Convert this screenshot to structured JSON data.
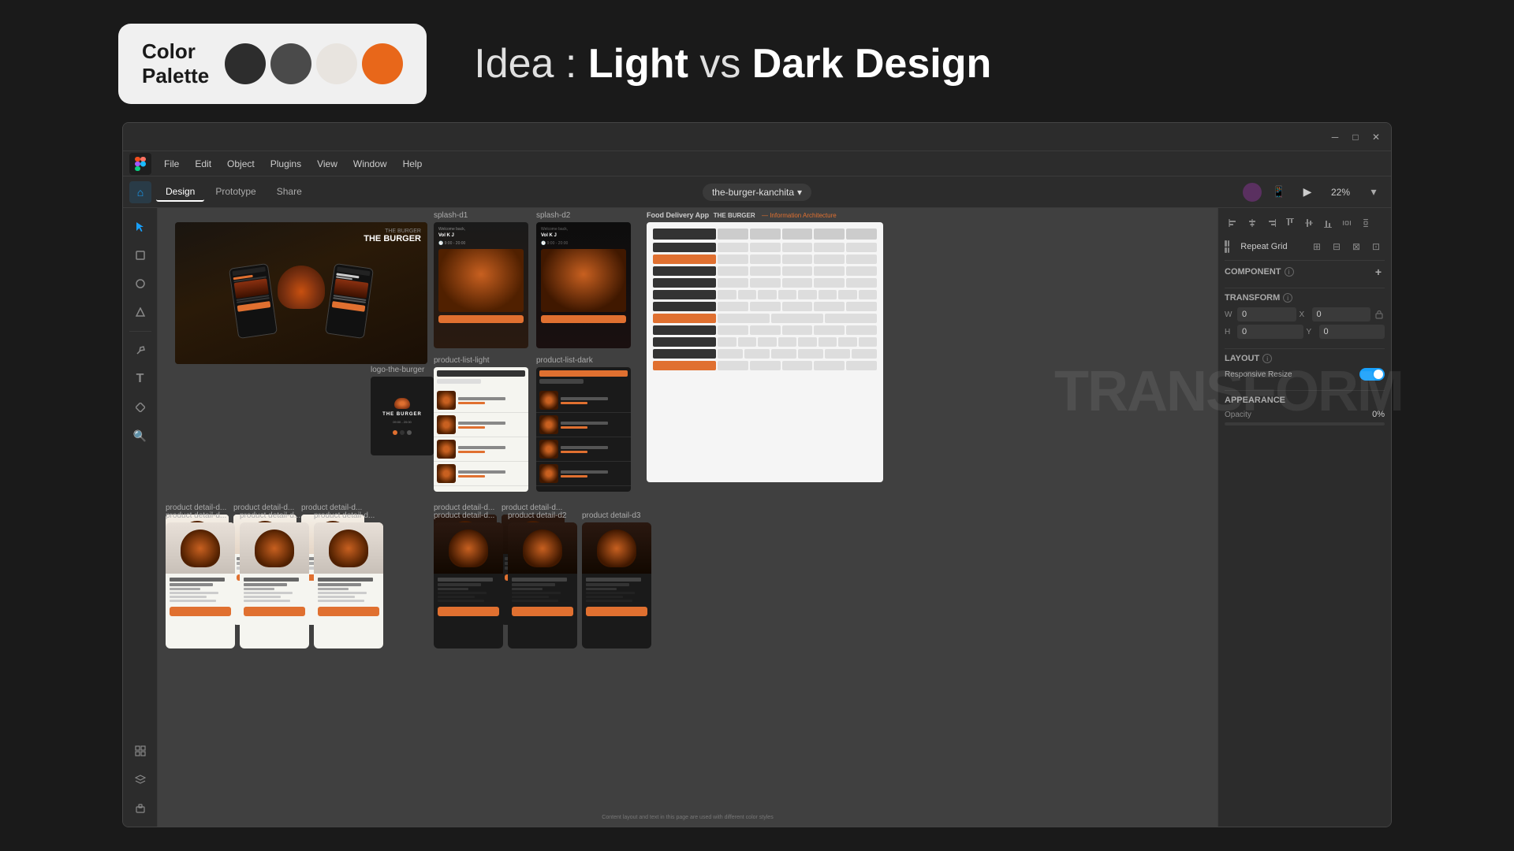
{
  "header": {
    "palette_label": "Color\nPalette",
    "palette_label_line1": "Color",
    "palette_label_line2": "Palette",
    "page_title_prefix": "Idea : ",
    "page_title_light": "Light",
    "page_title_vs": " vs ",
    "page_title_dark": "Dark Design",
    "colors": [
      {
        "name": "dark-charcoal",
        "hex": "#2d2d2d"
      },
      {
        "name": "medium-gray",
        "hex": "#4a4a4a"
      },
      {
        "name": "light-cream",
        "hex": "#e8e4df"
      },
      {
        "name": "orange-accent",
        "hex": "#e8671a"
      }
    ]
  },
  "window": {
    "title": "the-burger-kanchita",
    "controls": {
      "minimize": "─",
      "maximize": "□",
      "close": "✕"
    }
  },
  "menu": {
    "items": [
      "File",
      "Edit",
      "Object",
      "Plugins",
      "View",
      "Window",
      "Help"
    ]
  },
  "toolbar": {
    "tabs": [
      "Design",
      "Prototype",
      "Share"
    ],
    "active_tab": "Design",
    "file_name": "the-burger-kanchita",
    "zoom": "22%"
  },
  "canvas": {
    "frames": [
      {
        "label": "splash-d1",
        "type": "splash"
      },
      {
        "label": "splash-d2",
        "type": "splash"
      },
      {
        "label": "product-list-light",
        "type": "product-list-light"
      },
      {
        "label": "product-list-dark",
        "type": "product-list-dark"
      },
      {
        "label": "logo-the-burger",
        "type": "logo"
      },
      {
        "label": "product detail-d...",
        "type": "product-detail-light"
      },
      {
        "label": "product detail-d...",
        "type": "product-detail-light"
      },
      {
        "label": "product detail-d...",
        "type": "product-detail-light"
      },
      {
        "label": "product detail-d...",
        "type": "product-detail-dark"
      },
      {
        "label": "product detail-d...",
        "type": "product-detail-dark"
      },
      {
        "label": "product detail-d1",
        "type": "product-detail-dark"
      },
      {
        "label": "product detail-d2",
        "type": "product-detail-dark"
      },
      {
        "label": "product detail-d3",
        "type": "product-detail-dark"
      }
    ]
  },
  "right_panel": {
    "component_label": "COMPONENT",
    "transform_label": "TRANSFORM",
    "layout_label": "LAYOUT",
    "appearance_label": "APPEARANCE",
    "repeat_grid_label": "Repeat Grid",
    "responsive_resize_label": "Responsive Resize",
    "opacity_label": "Opacity",
    "opacity_value": "0%",
    "w_label": "W",
    "h_label": "H",
    "x_label": "X",
    "y_label": "Y",
    "w_value": "0",
    "h_value": "0",
    "x_value": "0",
    "y_value": "0"
  },
  "transform_overlay": {
    "text": "TRANSForM"
  }
}
